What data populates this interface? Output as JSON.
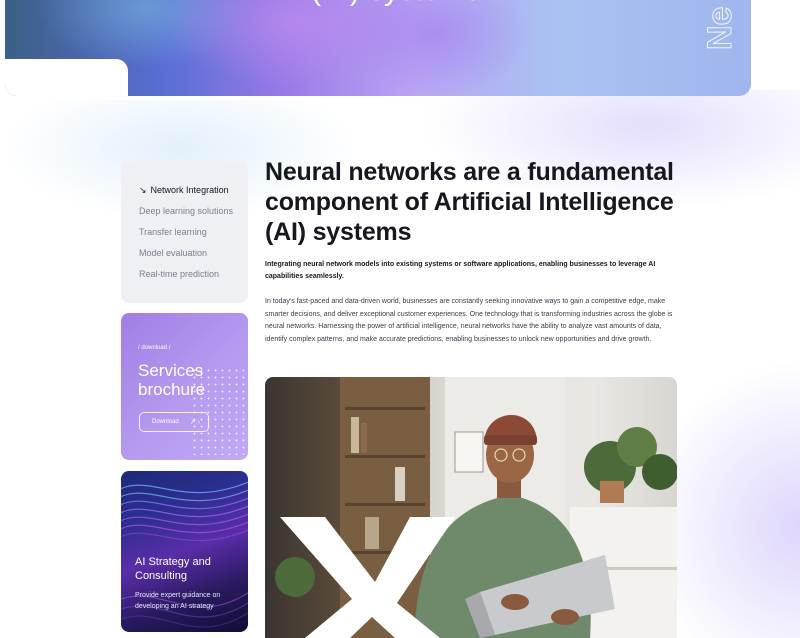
{
  "hero": {
    "title": "(AI) systems",
    "vertical_text": "Ne"
  },
  "nav": {
    "items": [
      {
        "label": "Network Integration",
        "active": true,
        "icon": "arrow-down-right-icon"
      },
      {
        "label": "Deep learning solutions",
        "active": false
      },
      {
        "label": "Transfer learning",
        "active": false
      },
      {
        "label": "Model evaluation",
        "active": false
      },
      {
        "label": "Real-time prediction",
        "active": false
      }
    ]
  },
  "brochure": {
    "tag": "/ download /",
    "title": "Services brochure",
    "button_label": "Download",
    "button_icon": "arrow-up-right-icon"
  },
  "strategy": {
    "title": "AI Strategy and Consulting",
    "description": "Provide expert guidance on developing an AI strategy"
  },
  "main": {
    "heading": "Neural networks are a fundamental component of Artificial Intelligence (AI) systems",
    "lead": "Integrating neural network models into existing systems or software applications, enabling businesses to leverage AI capabilities seamlessly.",
    "body": "In today's fast-paced and data-driven world, businesses are constantly seeking innovative ways to gain a competitive edge, make smarter decisions, and deliver exceptional customer experiences. One technology that is transforming industries across the globe is neural networks. Harnessing the power of artificial intelligence, neural networks have the ability to analyze vast amounts of data, identify complex patterns, and make accurate predictions, enabling businesses to unlock new opportunities and drive growth."
  },
  "colors": {
    "accent_purple": "#a07ee4",
    "dark_text": "#17181f",
    "nav_bg": "#eef0f4"
  }
}
